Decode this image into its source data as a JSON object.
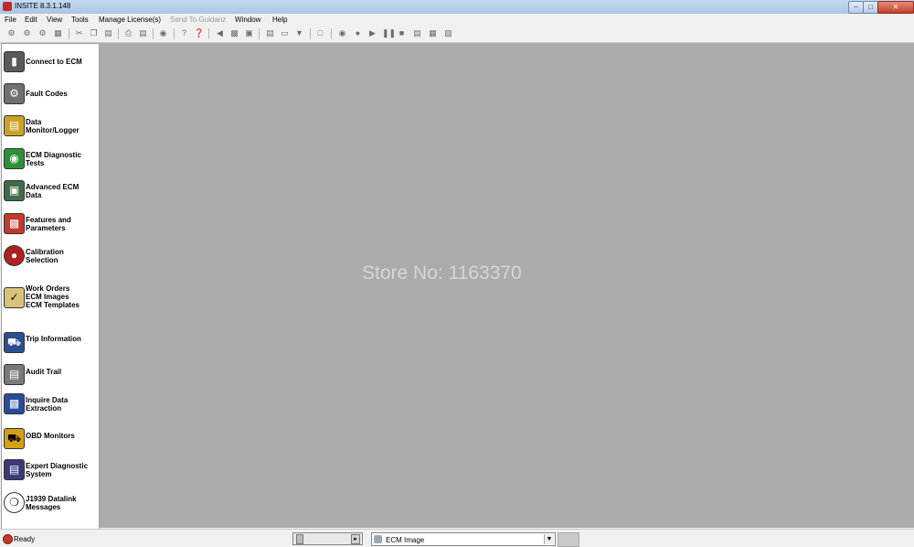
{
  "window": {
    "title": "INSITE 8.3.1.148"
  },
  "menu": [
    {
      "label": "File",
      "disabled": false
    },
    {
      "label": "Edit",
      "disabled": false
    },
    {
      "label": "View",
      "disabled": false
    },
    {
      "label": "Tools",
      "disabled": false
    },
    {
      "label": "Manage License(s)",
      "disabled": false
    },
    {
      "label": "Send To Guidanz",
      "disabled": true
    },
    {
      "label": "Window",
      "disabled": false
    },
    {
      "label": "Help",
      "disabled": false
    }
  ],
  "sidebar": {
    "items": [
      {
        "label": "Connect to ECM",
        "icon": "connect-ecm-icon",
        "color": "#5a5a5a"
      },
      {
        "label": "Fault Codes",
        "icon": "fault-codes-icon",
        "color": "#707070"
      },
      {
        "label": "Data\nMonitor/Logger",
        "icon": "data-monitor-icon",
        "color": "#c9a227"
      },
      {
        "label": "ECM Diagnostic\nTests",
        "icon": "ecm-diagnostic-icon",
        "color": "#2f8f3a"
      },
      {
        "label": "Advanced ECM\nData",
        "icon": "advanced-ecm-icon",
        "color": "#3f6b4a"
      },
      {
        "label": "Features and\nParameters",
        "icon": "features-parameters-icon",
        "color": "#c0392b"
      },
      {
        "label": "Calibration\nSelection",
        "icon": "calibration-icon",
        "color": "#b02020"
      },
      {
        "label": "Work Orders\nECM Images\nECM Templates",
        "icon": "work-orders-icon",
        "color": "#d9c27a"
      },
      {
        "label": "Trip Information",
        "icon": "trip-info-icon",
        "color": "#2c4f8f"
      },
      {
        "label": "Audit Trail",
        "icon": "audit-trail-icon",
        "color": "#7a7a7a"
      },
      {
        "label": "Inquire Data\nExtraction",
        "icon": "inquire-data-icon",
        "color": "#2a4a9a"
      },
      {
        "label": "OBD Monitors",
        "icon": "obd-monitors-icon",
        "color": "#d4a017"
      },
      {
        "label": "Expert Diagnostic\nSystem",
        "icon": "expert-diagnostic-icon",
        "color": "#3a3a7a"
      },
      {
        "label": "J1939 Datalink\nMessages",
        "icon": "j1939-icon",
        "color": "#333333"
      }
    ]
  },
  "workspace": {
    "watermark": "Store No: 1163370"
  },
  "status": {
    "text": "Ready",
    "combo_value": "ECM Image",
    "status_icon_color": "#c0392b"
  }
}
